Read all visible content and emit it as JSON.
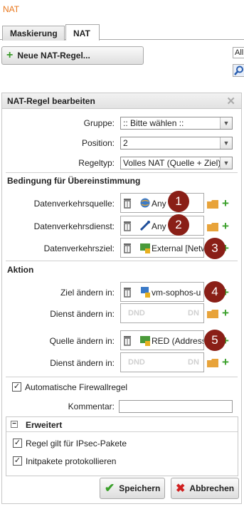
{
  "app_title": "NAT",
  "tabs": [
    {
      "label": "Maskierung"
    },
    {
      "label": "NAT"
    }
  ],
  "new_rule_button": "Neue NAT-Regel...",
  "side": {
    "all_label": "All"
  },
  "panel": {
    "title": "NAT-Regel bearbeiten",
    "gruppe": {
      "label": "Gruppe:",
      "value": ":: Bitte wählen ::"
    },
    "position": {
      "label": "Position:",
      "value": "2"
    },
    "regeltyp": {
      "label": "Regeltyp:",
      "value": "Volles NAT (Quelle + Ziel)"
    },
    "section_bedingung": "Bedingung für Übereinstimmung",
    "datenverkehrsquelle": {
      "label": "Datenverkehrsquelle:",
      "value": "Any",
      "badge": "1"
    },
    "datenverkehrsdienst": {
      "label": "Datenverkehrsdienst:",
      "value": "Any",
      "badge": "2"
    },
    "datenverkehrsziel": {
      "label": "Datenverkehrsziel:",
      "value": "External [Netw",
      "badge": "3"
    },
    "section_aktion": "Aktion",
    "ziel_aendern": {
      "label": "Ziel ändern in:",
      "value": "vm-sophos-u",
      "badge": "4"
    },
    "dienst_aendern_1": {
      "label": "Dienst ändern in:",
      "ph_left": "DND",
      "ph_right": "DN"
    },
    "quelle_aendern": {
      "label": "Quelle ändern in:",
      "value": "RED (Address",
      "badge": "5"
    },
    "dienst_aendern_2": {
      "label": "Dienst ändern in:",
      "ph_left": "DND",
      "ph_right": "DN"
    },
    "auto_firewall": {
      "label": "Automatische Firewallregel",
      "checked": true
    },
    "kommentar": {
      "label": "Kommentar:",
      "value": ""
    },
    "erweitert": {
      "title": "Erweitert",
      "ipsec": {
        "label": "Regel gilt für IPsec-Pakete",
        "checked": true
      },
      "initpakete": {
        "label": "Initpakete protokollieren",
        "checked": true
      }
    },
    "save_button": "Speichern",
    "cancel_button": "Abbrechen"
  },
  "colors": {
    "accent": "#e8761b",
    "badge": "#8a1f17",
    "plus": "#3aa02a"
  }
}
